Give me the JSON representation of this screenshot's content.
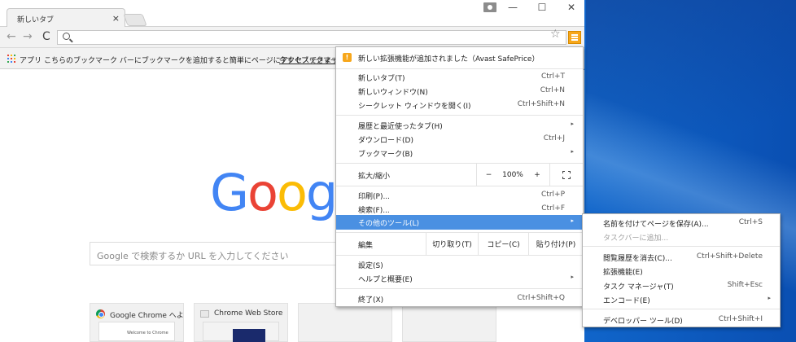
{
  "window": {
    "tab_title": "新しいタブ",
    "tab_close": "×",
    "controls": {
      "minimize": "—",
      "maximize": "☐",
      "close": "✕"
    }
  },
  "toolbar": {
    "back": "←",
    "forward": "→",
    "reload": "C",
    "star": "☆",
    "omnibox_value": ""
  },
  "bookmarks": {
    "apps_label": "アプリ",
    "hint": "こちらのブックマーク バーにブックマークを追加すると簡単にページにアクセスできます。",
    "import_link": "今すぐブックマークを"
  },
  "content": {
    "logo_letters": [
      "G",
      "o",
      "o",
      "g"
    ],
    "logo_colors": [
      "#4285f4",
      "#ea4335",
      "#fbbc05",
      "#4285f4"
    ],
    "search_placeholder": "Google で検索するか URL を入力してください",
    "tiles": [
      {
        "title": "Google Chrome へよ",
        "thumb_text": "Welcome to Chrome"
      },
      {
        "title": "Chrome Web Store",
        "thumb_text": ""
      },
      {
        "title": "",
        "thumb_text": ""
      },
      {
        "title": "",
        "thumb_text": ""
      }
    ]
  },
  "menu": {
    "extension_notice": "新しい拡張機能が追加されました（Avast SafePrice）",
    "items": {
      "new_tab": {
        "label": "新しいタブ(T)",
        "shortcut": "Ctrl+T"
      },
      "new_window": {
        "label": "新しいウィンドウ(N)",
        "shortcut": "Ctrl+N"
      },
      "incognito": {
        "label": "シークレット ウィンドウを開く(I)",
        "shortcut": "Ctrl+Shift+N"
      },
      "history": {
        "label": "履歴と最近使ったタブ(H)"
      },
      "downloads": {
        "label": "ダウンロード(D)",
        "shortcut": "Ctrl+J"
      },
      "bookmarks": {
        "label": "ブックマーク(B)"
      },
      "print": {
        "label": "印刷(P)...",
        "shortcut": "Ctrl+P"
      },
      "find": {
        "label": "検索(F)...",
        "shortcut": "Ctrl+F"
      },
      "more_tools": {
        "label": "その他のツール(L)"
      },
      "settings": {
        "label": "設定(S)"
      },
      "help": {
        "label": "ヘルプと概要(E)"
      },
      "exit": {
        "label": "終了(X)",
        "shortcut": "Ctrl+Shift+Q"
      }
    },
    "zoom": {
      "label": "拡大/縮小",
      "minus": "−",
      "value": "100%",
      "plus": "+"
    },
    "edit": {
      "label": "編集",
      "cut": "切り取り(T)",
      "copy": "コピー(C)",
      "paste": "貼り付け(P)"
    },
    "arrow": "▸"
  },
  "submenu": {
    "save_page": {
      "label": "名前を付けてページを保存(A)...",
      "shortcut": "Ctrl+S"
    },
    "add_to_taskbar": {
      "label": "タスクバーに追加..."
    },
    "clear_data": {
      "label": "閲覧履歴を消去(C)...",
      "shortcut": "Ctrl+Shift+Delete"
    },
    "extensions": {
      "label": "拡張機能(E)"
    },
    "task_manager": {
      "label": "タスク マネージャ(T)",
      "shortcut": "Shift+Esc"
    },
    "encoding": {
      "label": "エンコード(E)"
    },
    "devtools": {
      "label": "デベロッパー ツール(D)",
      "shortcut": "Ctrl+Shift+I"
    }
  },
  "colors": {
    "accent_menu_button": "#f7a71b",
    "highlight": "#4a90e2"
  }
}
